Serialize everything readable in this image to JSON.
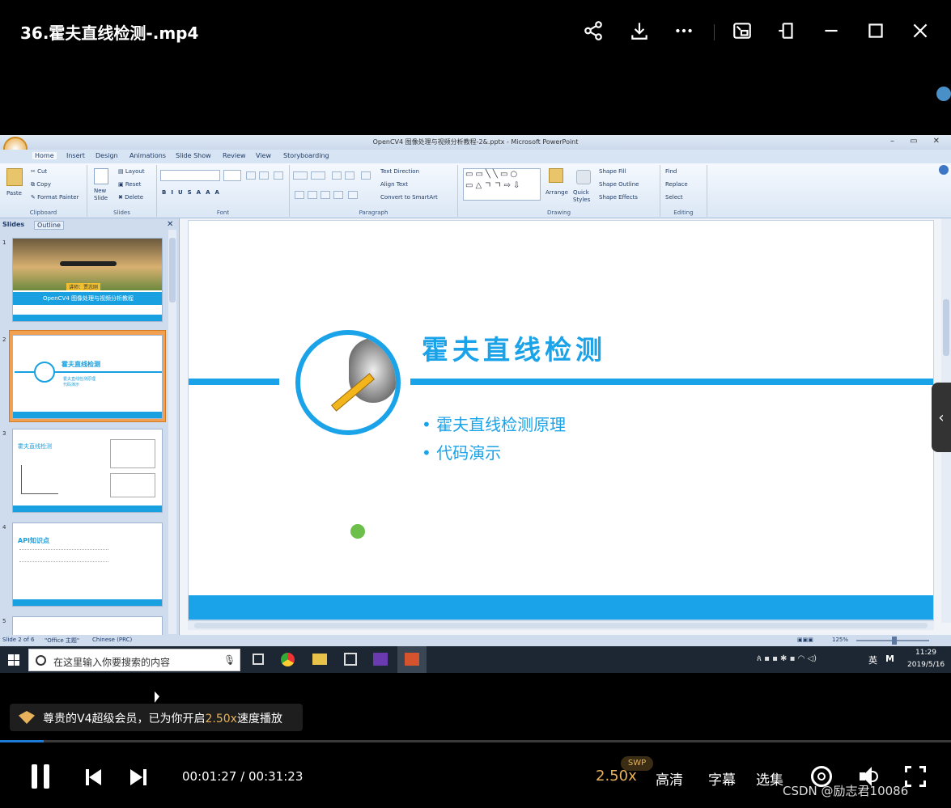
{
  "player": {
    "title": "36.霍夫直线检测-.mp4",
    "time_current": "00:01:27",
    "time_separator": "/",
    "time_total": "00:31:23",
    "progress": 0.046,
    "speed": "2.50x",
    "speed_badge": "SWP",
    "quality": "高清",
    "subtitle_label": "字幕",
    "episodes_label": "选集",
    "notice": {
      "text_before": "尊贵的V4超级会员，已为你开启",
      "speed_highlight": "2.50x",
      "text_after": "速度播放"
    },
    "watermark": "CSDN @励志君10086",
    "icons": [
      "share-icon",
      "download-icon",
      "more-icon",
      "pip-icon",
      "pin-icon",
      "minimize-icon",
      "maximize-icon",
      "close-icon",
      "pause-icon",
      "prev-icon",
      "next-icon",
      "danmaku-icon",
      "volume-icon",
      "fullscreen-icon",
      "collapse-arrow-icon"
    ]
  },
  "powerpoint": {
    "window_title": "OpenCV4 图像处理与视频分析教程-2&.pptx - Microsoft PowerPoint",
    "tabs": [
      "Home",
      "Insert",
      "Design",
      "Animations",
      "Slide Show",
      "Review",
      "View",
      "Storyboarding"
    ],
    "ribbon": {
      "clipboard": {
        "paste": "Paste",
        "cut": "Cut",
        "copy": "Copy",
        "format_painter": "Format Painter",
        "label": "Clipboard"
      },
      "slides": {
        "new_slide": "New Slide",
        "layout": "Layout",
        "reset": "Reset",
        "delete": "Delete",
        "label": "Slides"
      },
      "font": {
        "label": "Font"
      },
      "paragraph": {
        "text_direction": "Text Direction",
        "align_text": "Align Text",
        "convert_smartart": "Convert to SmartArt",
        "label": "Paragraph"
      },
      "drawing": {
        "arrange": "Arrange",
        "quick_styles": "Quick Styles",
        "shape_fill": "Shape Fill",
        "shape_outline": "Shape Outline",
        "shape_effects": "Shape Effects",
        "label": "Drawing"
      },
      "editing": {
        "find": "Find",
        "replace": "Replace",
        "select": "Select",
        "label": "Editing"
      }
    },
    "panel_tabs": [
      "Slides",
      "Outline"
    ],
    "thumbnails": [
      {
        "num": "1",
        "title": "OpenCV4 图像处理与视频分析教程",
        "badge": "讲师：贾志刚"
      },
      {
        "num": "2",
        "title": "霍夫直线检测",
        "items": [
          "霍夫直线检测原理",
          "代码演示"
        ]
      },
      {
        "num": "3",
        "title": "霍夫直线检测"
      },
      {
        "num": "4",
        "title": "API知识点"
      },
      {
        "num": "5",
        "title": ""
      }
    ],
    "slide": {
      "title": "霍夫直线检测",
      "bullets": [
        "霍夫直线检测原理",
        "代码演示"
      ],
      "accent_color": "#1aa3e8"
    },
    "status": {
      "slide_info": "Slide 2 of 6",
      "theme": "\"Office 主题\"",
      "language": "Chinese (PRC)",
      "zoom": "125%"
    }
  },
  "taskbar": {
    "search_placeholder": "在这里输入你要搜索的内容",
    "time": "11:29",
    "date": "2019/5/16",
    "ime": "英"
  }
}
